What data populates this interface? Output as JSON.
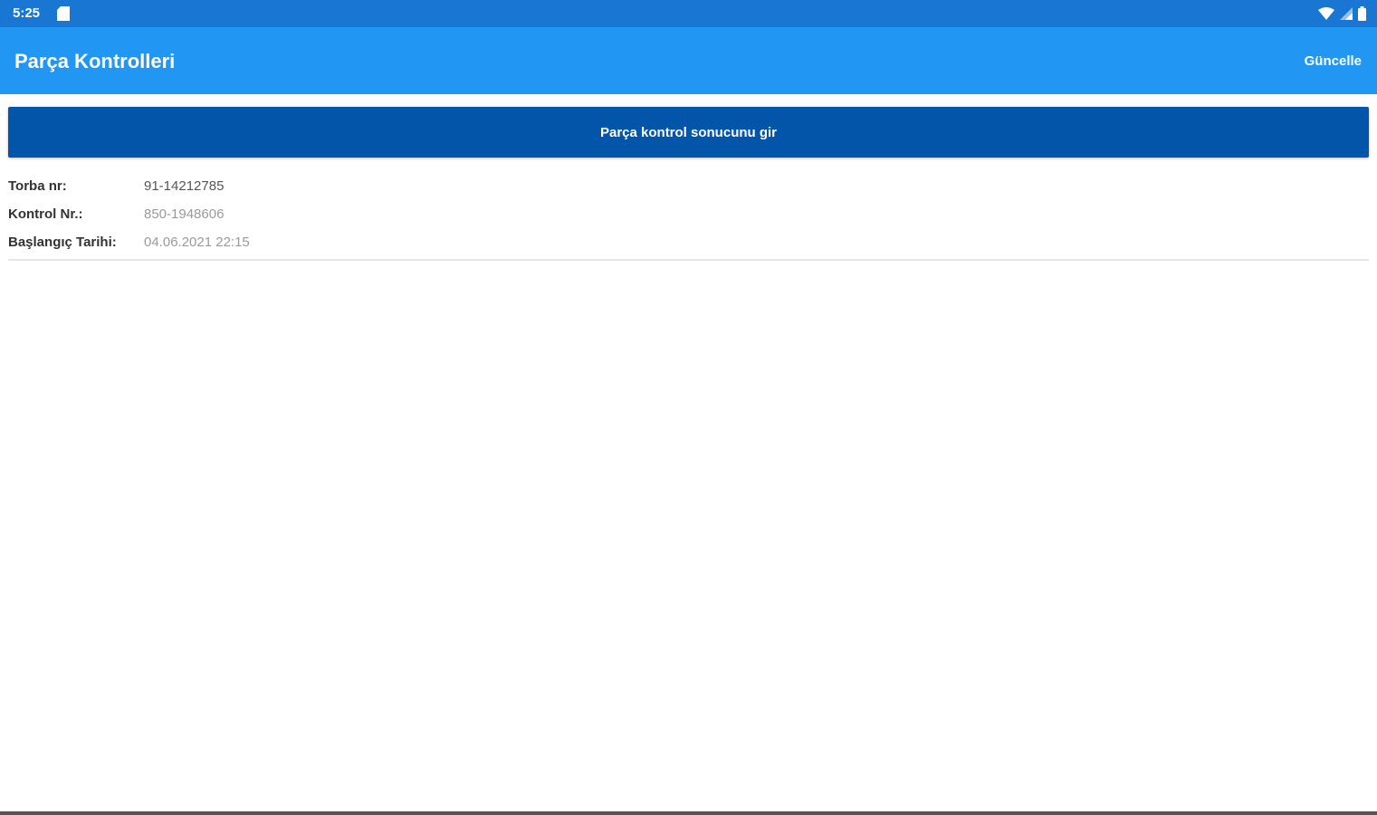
{
  "status_bar": {
    "time": "5:25",
    "icons": [
      "sd-card-icon",
      "wifi-icon",
      "signal-icon",
      "battery-icon"
    ],
    "color": "#1976d2"
  },
  "app_bar": {
    "title": "Parça Kontrolleri",
    "refresh_label": "Güncelle",
    "color": "#2196f3"
  },
  "primary_action": {
    "label": "Parça kontrol sonucunu gir",
    "color": "#0255a8"
  },
  "details": [
    {
      "label": "Torba nr:",
      "value": "91-14212785"
    },
    {
      "label": "Kontrol Nr.:",
      "value": "850-1948606"
    },
    {
      "label": "Başlangıç Tarihi:",
      "value": "04.06.2021 22:15"
    }
  ]
}
